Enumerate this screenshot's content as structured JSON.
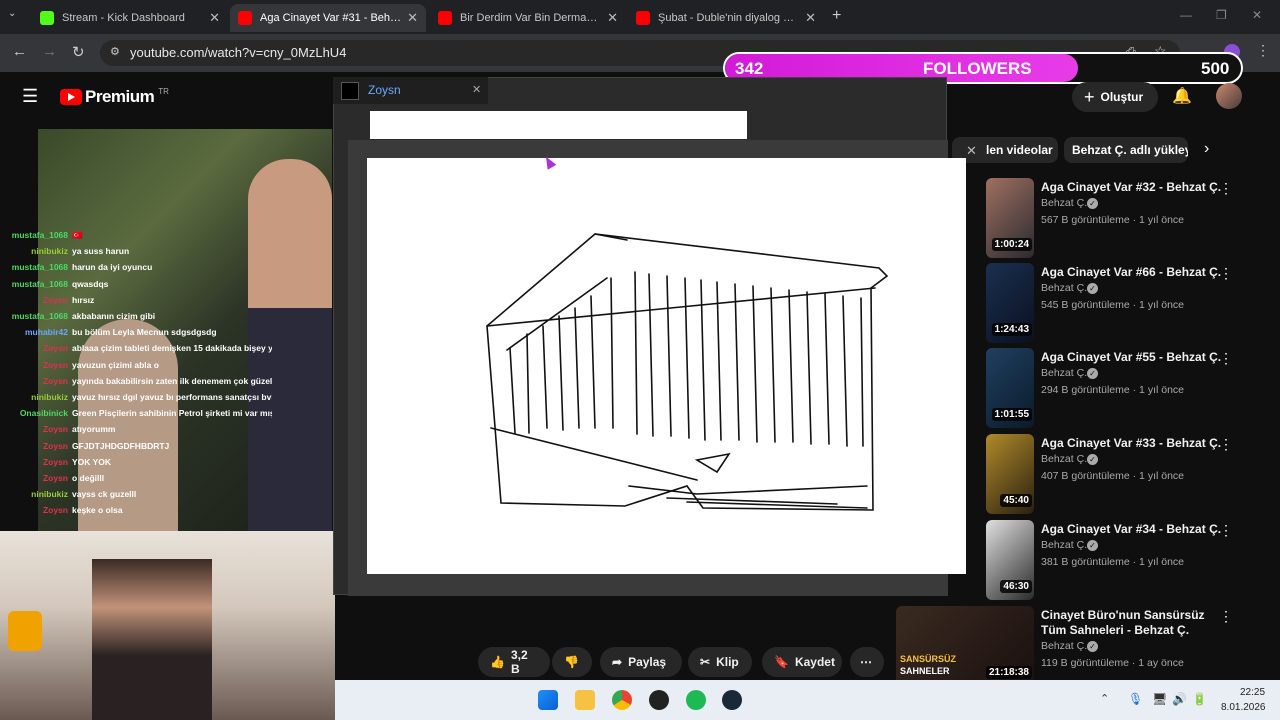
{
  "browser": {
    "tabs": [
      {
        "title": "Stream - Kick Dashboard",
        "color": "#53fc18"
      },
      {
        "title": "Aga Cinayet Var #31 - Behzat Ç",
        "color": "#ff0000"
      },
      {
        "title": "Bir Derdim Var Bin Dermana De",
        "color": "#ff0000"
      },
      {
        "title": "Şubat - Duble'nin diyalog görü",
        "color": "#ff0000"
      }
    ],
    "url": "youtube.com/watch?v=cny_0MzLhU4"
  },
  "followers": {
    "current": "342",
    "label": "FOLLOWERS",
    "goal": "500",
    "progress": 0.684
  },
  "youtube": {
    "logo": "Premium",
    "region": "TR",
    "create_label": "Oluştur",
    "chips": [
      "len videolar",
      "Behzat Ç. adlı yükleyi"
    ],
    "related": [
      {
        "title": "Aga Cinayet Var #32 - Behzat Ç.",
        "channel": "Behzat Ç.",
        "meta": "567 B görüntüleme · 1 yıl önce",
        "duration": "1:00:24"
      },
      {
        "title": "Aga Cinayet Var #66 - Behzat Ç.",
        "channel": "Behzat Ç.",
        "meta": "545 B görüntüleme · 1 yıl önce",
        "duration": "1:24:43"
      },
      {
        "title": "Aga Cinayet Var #55 - Behzat Ç.",
        "channel": "Behzat Ç.",
        "meta": "294 B görüntüleme · 1 yıl önce",
        "duration": "1:01:55"
      },
      {
        "title": "Aga Cinayet Var #33 - Behzat Ç.",
        "channel": "Behzat Ç.",
        "meta": "407 B görüntüleme · 1 yıl önce",
        "duration": "45:40"
      },
      {
        "title": "Aga Cinayet Var #34 - Behzat Ç.",
        "channel": "Behzat Ç.",
        "meta": "381 B görüntüleme · 1 yıl önce",
        "duration": "46:30"
      },
      {
        "title": "Cinayet Büro'nun Sansürsüz",
        "title2": "Tüm Sahneleri - Behzat Ç.",
        "channel": "Behzat Ç.",
        "meta": "119 B görüntüleme · 1 ay önce",
        "duration": "21:18:38",
        "thumb_text1": "SANSÜRSÜZ",
        "thumb_text2": "SAHNELER"
      }
    ],
    "actions": {
      "likes": "3,2 B",
      "share": "Paylaş",
      "clip": "Klip",
      "save": "Kaydet"
    }
  },
  "window": {
    "title": "Zoysn"
  },
  "chat": [
    {
      "user": "mustafa_1068",
      "msg": "🇹🇷",
      "color": "#4cd964"
    },
    {
      "user": "ninibukiz",
      "msg": "ya suss harun",
      "color": "#9acd32"
    },
    {
      "user": "mustafa_1068",
      "msg": "harun da iyi oyuncu",
      "color": "#4cd964"
    },
    {
      "user": "mustafa_1068",
      "msg": "qwasdqs",
      "color": "#4cd964"
    },
    {
      "user": "Zoysn",
      "msg": "hırsız",
      "color": "#e0304e"
    },
    {
      "user": "mustafa_1068",
      "msg": "akbabanın cizim gibi",
      "color": "#4cd964"
    },
    {
      "user": "muhabir42",
      "msg": "bu bölüm Leyla Mecnun sdgsdgsdg",
      "color": "#6aa6ff"
    },
    {
      "user": "Zoysn",
      "msg": "ablaaa çizim tableti demişken 15 dakikada bişey yar",
      "color": "#e0304e"
    },
    {
      "user": "Zoysn",
      "msg": "yavuzun çizimi abla o",
      "color": "#e0304e"
    },
    {
      "user": "Zoysn",
      "msg": "yayında bakabilirsin zaten ilk denemem çok güzel ol",
      "color": "#e0304e"
    },
    {
      "user": "ninibukiz",
      "msg": "yavuz hırsız dgıl yavuz bı performans sanatçsı bvbı",
      "color": "#9acd32"
    },
    {
      "user": "Onasibinick",
      "msg": "Green Pisçilerin sahibinin Petrol şirketi mi var mış a",
      "color": "#4cd964"
    },
    {
      "user": "Zoysn",
      "msg": "atıyorumm",
      "color": "#e0304e"
    },
    {
      "user": "Zoysn",
      "msg": "GFJDTJHDGDFHBDRTJ",
      "color": "#e0304e"
    },
    {
      "user": "Zoysn",
      "msg": "YOK YOK",
      "color": "#e0304e"
    },
    {
      "user": "Zoysn",
      "msg": "o değilll",
      "color": "#e0304e"
    },
    {
      "user": "ninibukiz",
      "msg": "vayss ck guzelll",
      "color": "#9acd32"
    },
    {
      "user": "Zoysn",
      "msg": "keşke o olsa",
      "color": "#e0304e"
    }
  ],
  "taskbar": {
    "time": "22:25",
    "date": "8.01.2026"
  }
}
